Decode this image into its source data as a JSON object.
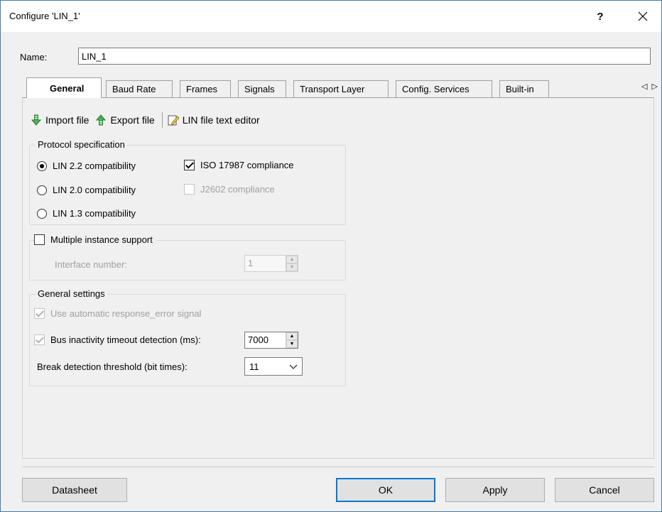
{
  "window": {
    "title": "Configure 'LIN_1'",
    "help_label": "?"
  },
  "name": {
    "label": "Name:",
    "value": "LIN_1"
  },
  "tabs": [
    {
      "label": "General",
      "active": true
    },
    {
      "label": "Baud Rate"
    },
    {
      "label": "Frames"
    },
    {
      "label": "Signals"
    },
    {
      "label": "Transport Layer"
    },
    {
      "label": "Config. Services"
    },
    {
      "label": "Built-in"
    }
  ],
  "tab_scroll": {
    "left": "◁",
    "right": "▷"
  },
  "toolbar": {
    "import_label": "Import file",
    "export_label": "Export file",
    "editor_label": "LIN file text editor"
  },
  "protocol": {
    "title": "Protocol specification",
    "radios": [
      {
        "label": "LIN 2.2 compatibility",
        "checked": true
      },
      {
        "label": "LIN 2.0 compatibility",
        "checked": false
      },
      {
        "label": "LIN 1.3 compatibility",
        "checked": false
      }
    ],
    "iso_label": "ISO 17987 compliance",
    "iso_checked": true,
    "j2602_label": "J2602 compliance",
    "j2602_checked": false
  },
  "multi_instance": {
    "label": "Multiple instance support",
    "checked": false,
    "interface_label": "Interface number:",
    "interface_value": "1"
  },
  "general_settings": {
    "title": "General settings",
    "auto_resp_label": "Use automatic response_error signal",
    "bus_inactivity_label": "Bus inactivity timeout detection (ms):",
    "bus_inactivity_value": "7000",
    "break_label": "Break detection threshold (bit times):",
    "break_value": "11"
  },
  "buttons": {
    "datasheet": "Datasheet",
    "ok": "OK",
    "apply": "Apply",
    "cancel": "Cancel"
  },
  "colors": {
    "accent": "#0078d7",
    "border": "#3c7fb1"
  }
}
